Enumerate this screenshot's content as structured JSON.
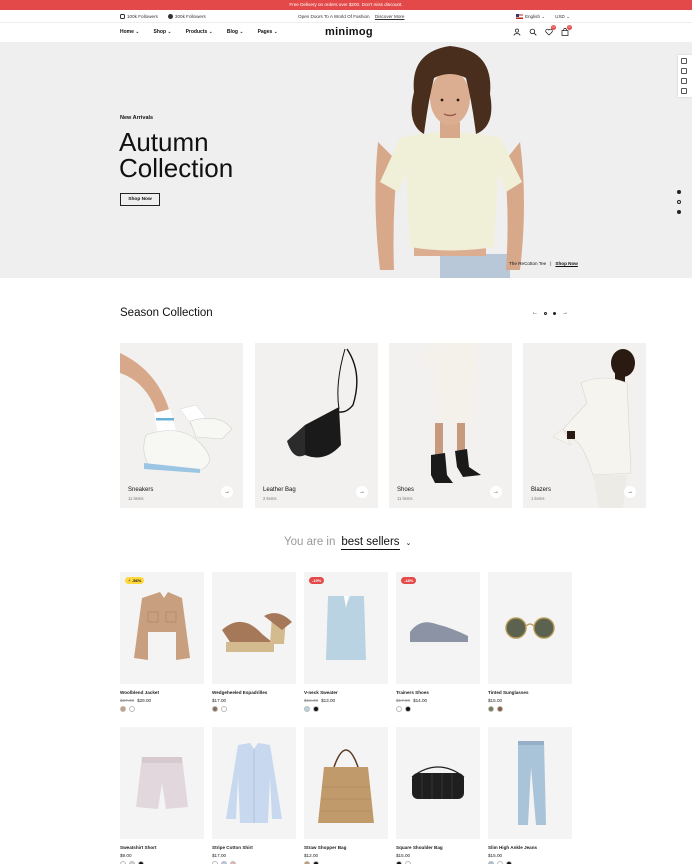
{
  "promo": {
    "text": "Free Delivery on orders over $200. Don't miss discount."
  },
  "topbar": {
    "instagram": "100k Followers",
    "facebook": "300k Followers",
    "announce": "Open Doors To A World Of Fashion",
    "announce_link": "Discover More",
    "language": "English",
    "currency": "USD"
  },
  "nav": {
    "menu": [
      "Home",
      "Shop",
      "Products",
      "Blog",
      "Pages"
    ],
    "logo": "minimog",
    "wishlist_count": "0",
    "cart_count": "0"
  },
  "hero": {
    "eyebrow": "New Arrivals",
    "title_line1": "Autumn",
    "title_line2": "Collection",
    "button": "Shop Now",
    "caption_product": "The ReCotton Tee",
    "caption_link": "Shop Now"
  },
  "season": {
    "title": "Season Collection",
    "categories": [
      {
        "label": "Sneakers",
        "count": "11 items"
      },
      {
        "label": "Leather Bag",
        "count": "2 items"
      },
      {
        "label": "Shoes",
        "count": "11 items"
      },
      {
        "label": "Blazers",
        "count": "1 items"
      }
    ]
  },
  "bestsellers": {
    "prefix": "You are in",
    "selected": "best sellers"
  },
  "products": [
    {
      "name": "Woolblend Jacket",
      "old": "$37.00",
      "price": "$29.00",
      "tag": "⚡ -56%",
      "tag_type": "hot",
      "swatches": [
        "#c9a07f",
        "#ffffff"
      ]
    },
    {
      "name": "Wedgeheeled Espadrilles",
      "old": "",
      "price": "$17.00",
      "tag": "",
      "tag_type": "",
      "swatches": [
        "#8a6d55",
        "#ffffff"
      ]
    },
    {
      "name": "V-neck Sweater",
      "old": "$16.00",
      "price": "$13.00",
      "tag": "-19%",
      "tag_type": "sale",
      "swatches": [
        "#b9d3e3",
        "#111111"
      ]
    },
    {
      "name": "Trainers Shoes",
      "old": "$17.00",
      "price": "$14.00",
      "tag": "-18%",
      "tag_type": "sale",
      "swatches": [
        "#ffffff",
        "#111111"
      ]
    },
    {
      "name": "Tinted Sunglasses",
      "old": "",
      "price": "$15.00",
      "tag": "",
      "tag_type": "",
      "swatches": [
        "#7c7a5e",
        "#8a5a3c"
      ]
    },
    {
      "name": "Sweatshirt Short",
      "old": "",
      "price": "$9.00",
      "tag": "",
      "tag_type": "",
      "swatches": [
        "#ffffff",
        "#dcd0d6",
        "#111111"
      ]
    },
    {
      "name": "Stripe Cotton Shirt",
      "old": "",
      "price": "$17.00",
      "tag": "",
      "tag_type": "",
      "swatches": [
        "#ffffff",
        "#b7c9e6",
        "#e3b9b9"
      ]
    },
    {
      "name": "Straw Shopper Bag",
      "old": "",
      "price": "$12.00",
      "tag": "",
      "tag_type": "",
      "swatches": [
        "#c19a6b",
        "#111111"
      ]
    },
    {
      "name": "Square Shoulder Bag",
      "old": "",
      "price": "$15.00",
      "tag": "",
      "tag_type": "",
      "swatches": [
        "#111111",
        "#ffffff"
      ]
    },
    {
      "name": "Slim High Ankle Jeans",
      "old": "",
      "price": "$15.00",
      "tag": "",
      "tag_type": "",
      "swatches": [
        "#a9c3d9",
        "#ffffff",
        "#111111"
      ]
    }
  ]
}
